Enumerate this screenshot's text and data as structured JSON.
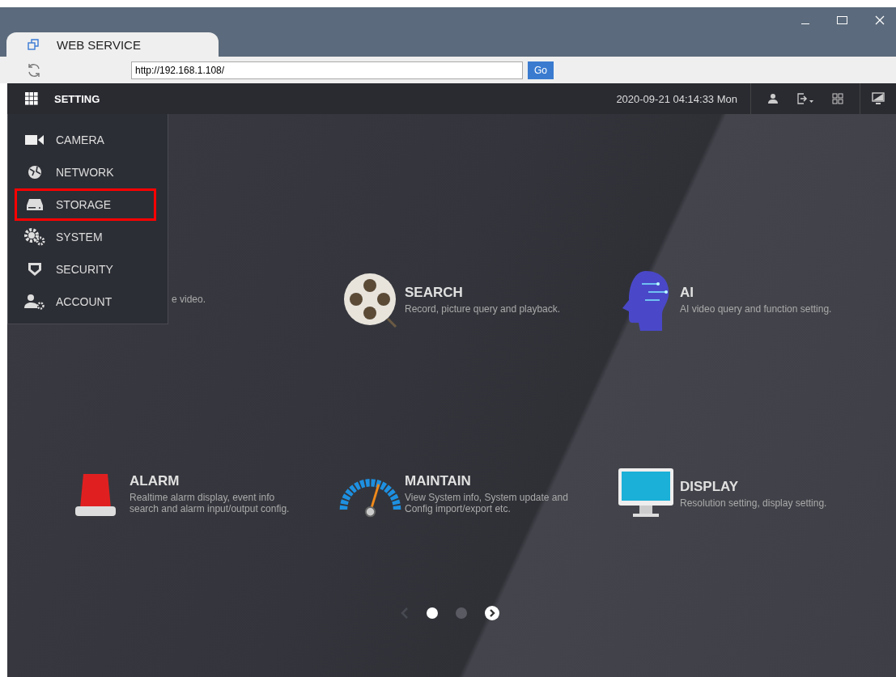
{
  "window": {
    "tab_title": "WEB SERVICE"
  },
  "address_bar": {
    "url": "http://192.168.1.108/",
    "go_button": "Go"
  },
  "nav": {
    "title": "SETTING",
    "datetime": "2020-09-21 04:14:33 Mon"
  },
  "menu": [
    {
      "kind": "camera",
      "label": "CAMERA",
      "annotated": false
    },
    {
      "kind": "network",
      "label": "NETWORK",
      "annotated": false
    },
    {
      "kind": "storage",
      "label": "STORAGE",
      "annotated": true
    },
    {
      "kind": "system",
      "label": "SYSTEM",
      "annotated": false
    },
    {
      "kind": "security",
      "label": "SECURITY",
      "annotated": false
    },
    {
      "kind": "account",
      "label": "ACCOUNT",
      "annotated": false
    }
  ],
  "tiles": [
    {
      "kind": "live",
      "description": "e video."
    },
    {
      "kind": "search",
      "title": "SEARCH",
      "description": "Record, picture query and playback."
    },
    {
      "kind": "ai",
      "title": "AI",
      "description": "AI video query and function setting."
    },
    {
      "kind": "alarm",
      "title": "ALARM",
      "description": "Realtime alarm display, event info search and alarm input/output config."
    },
    {
      "kind": "maintain",
      "title": "MAINTAIN",
      "description": "View System info, System update and Config import/export etc."
    },
    {
      "kind": "display",
      "title": "DISPLAY",
      "description": "Resolution setting, display setting."
    }
  ],
  "pager": [
    {
      "selected": true
    },
    {
      "selected": false
    }
  ]
}
